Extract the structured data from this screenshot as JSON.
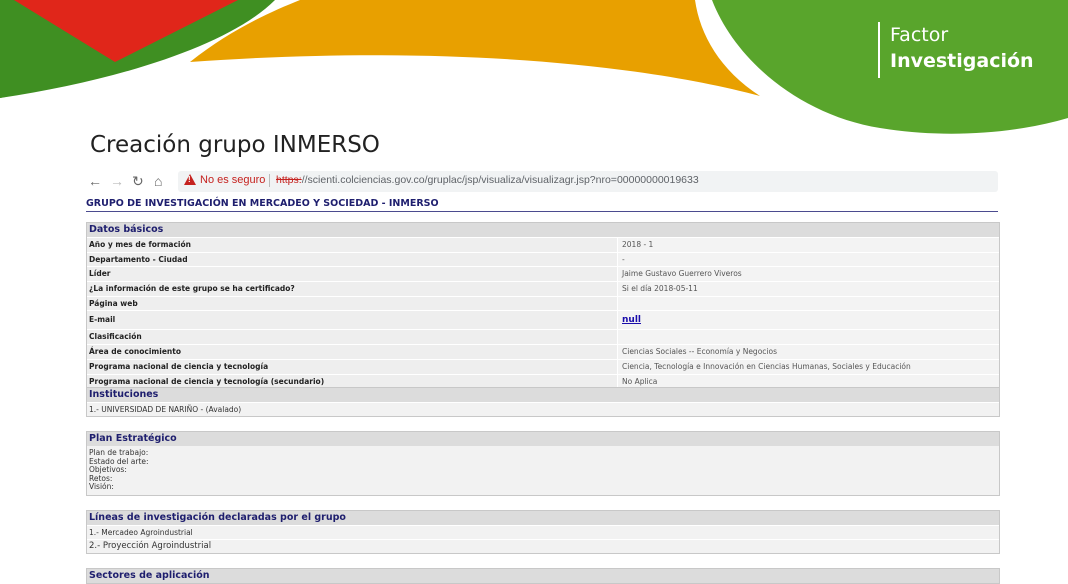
{
  "brand": {
    "line1": "Factor",
    "line2": "Investigación"
  },
  "slide_title": "Creación grupo INMERSO",
  "browser": {
    "warning": "No es seguro",
    "url_protocol": "https:",
    "url_rest": "//scienti.colciencias.gov.co/gruplac/jsp/visualiza/visualizagr.jsp?nro=00000000019633"
  },
  "group_title": "GRUPO DE INVESTIGACIÓN EN MERCADEO Y SOCIEDAD - INMERSO",
  "datos_basicos": {
    "heading": "Datos básicos",
    "rows": [
      {
        "label": "Año y mes de formación",
        "value": "2018 - 1"
      },
      {
        "label": "Departamento - Ciudad",
        "value": "-"
      },
      {
        "label": "Líder",
        "value": "Jaime Gustavo Guerrero Viveros"
      },
      {
        "label": "¿La información de este grupo se ha certificado?",
        "value": "Si el día 2018-05-11"
      },
      {
        "label": "Página web",
        "value": ""
      },
      {
        "label": "E-mail",
        "value": "null"
      },
      {
        "label": "Clasificación",
        "value": ""
      },
      {
        "label": "Área de conocimiento",
        "value": "Ciencias Sociales -- Economía y Negocios"
      },
      {
        "label": "Programa nacional de ciencia y tecnología",
        "value": "Ciencia, Tecnología e Innovación en Ciencias Humanas, Sociales y Educación"
      },
      {
        "label": "Programa nacional de ciencia y tecnología (secundario)",
        "value": "No Aplica"
      }
    ]
  },
  "instituciones": {
    "heading": "Instituciones",
    "items": [
      "1.- UNIVERSIDAD DE NARIÑO - (Avalado)"
    ]
  },
  "plan_estrategico": {
    "heading": "Plan Estratégico",
    "lines": [
      "Plan de trabajo:",
      "Estado del arte:",
      "Objetivos:",
      "Retos:",
      "Visión:"
    ]
  },
  "lineas": {
    "heading": "Líneas de investigación declaradas por el grupo",
    "items": [
      "1.- Mercadeo Agroindustrial",
      "2.- Proyección Agroindustrial"
    ]
  },
  "sectores": {
    "heading": "Sectores de aplicación"
  },
  "colors": {
    "green": "#4a9a24",
    "red": "#e0261a",
    "orange": "#e8a000",
    "header_text": "#1e1e6e"
  }
}
